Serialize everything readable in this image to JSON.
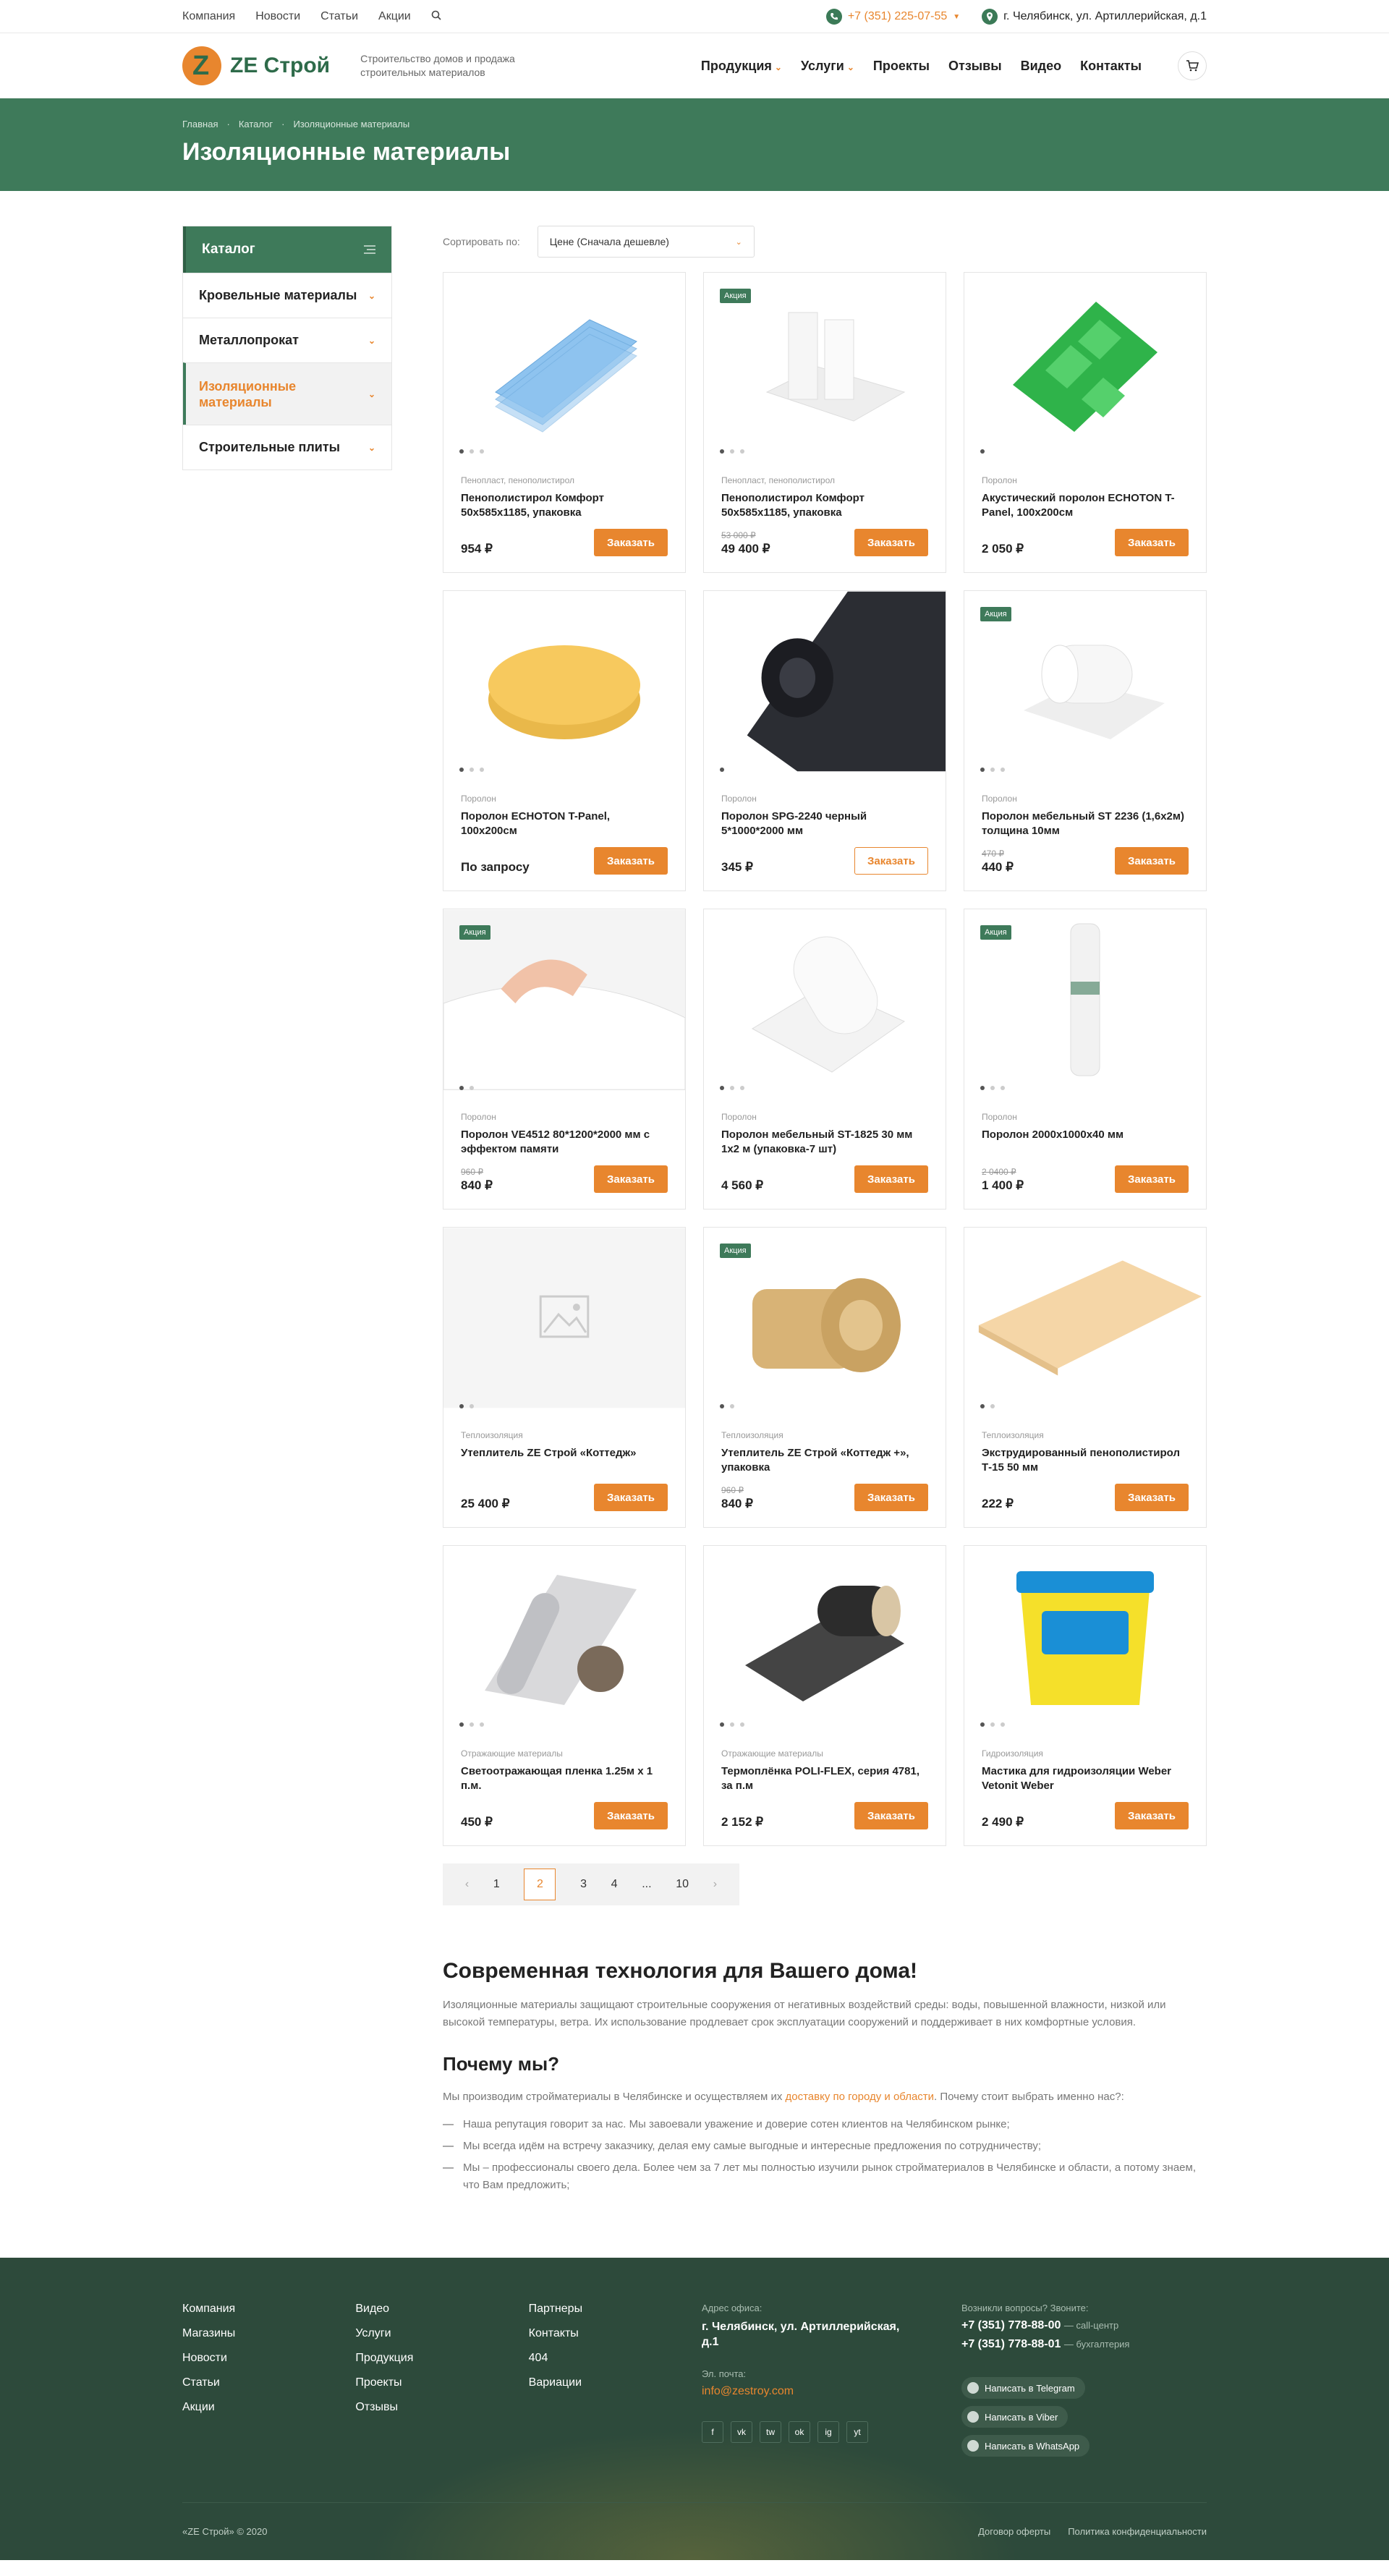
{
  "topnav": [
    "Компания",
    "Новости",
    "Статьи",
    "Акции"
  ],
  "phone": "+7 (351) 225-07-55",
  "address": "г. Челябинск, ул. Артиллерийская, д.1",
  "logo_text": "ZE Строй",
  "tagline": "Строительство домов и продажа строительных материалов",
  "mainnav": [
    {
      "label": "Продукция",
      "dropdown": true
    },
    {
      "label": "Услуги",
      "dropdown": true
    },
    {
      "label": "Проекты",
      "dropdown": false
    },
    {
      "label": "Отзывы",
      "dropdown": false
    },
    {
      "label": "Видео",
      "dropdown": false
    },
    {
      "label": "Контакты",
      "dropdown": false
    }
  ],
  "breadcrumbs": [
    "Главная",
    "Каталог",
    "Изоляционные материалы"
  ],
  "page_title": "Изоляционные материалы",
  "sidebar": {
    "title": "Каталог",
    "items": [
      {
        "label": "Кровельные материалы",
        "active": false
      },
      {
        "label": "Металлопрокат",
        "active": false
      },
      {
        "label": "Изоляционные материалы",
        "active": true
      },
      {
        "label": "Строительные плиты",
        "active": false
      }
    ]
  },
  "sort": {
    "label": "Сортировать по:",
    "value": "Цене (Сначала дешевле)"
  },
  "products": [
    {
      "img": "blue-boards",
      "badge": "",
      "dots": 3,
      "cat": "Пенопласт, пенополистирол",
      "title": "Пенополистирол Комфорт 50х585х1185, упаковка",
      "old": "",
      "price": "954 ₽",
      "btn": "Заказать",
      "outline": false
    },
    {
      "img": "white-blocks",
      "badge": "Акция",
      "dots": 3,
      "cat": "Пенопласт, пенополистирол",
      "title": "Пенополистирол Комфорт 50х585х1185, упаковка",
      "old": "53 000 ₽",
      "price": "49 400 ₽",
      "btn": "Заказать",
      "outline": false
    },
    {
      "img": "green-panel",
      "badge": "",
      "dots": 1,
      "cat": "Поролон",
      "title": "Акустический поролон ECHOTON T-Panel, 100х200см",
      "old": "",
      "price": "2 050 ₽",
      "btn": "Заказать",
      "outline": false
    },
    {
      "img": "yellow-disc",
      "badge": "",
      "dots": 3,
      "cat": "Поролон",
      "title": "Поролон ECHOTON T-Panel, 100х200см",
      "old": "",
      "price": "По запросу",
      "btn": "Заказать",
      "outline": false
    },
    {
      "img": "black-roll",
      "badge": "",
      "dots": 1,
      "cat": "Поролон",
      "title": "Поролон SPG-2240 черный 5*1000*2000 мм",
      "old": "",
      "price": "345 ₽",
      "btn": "Заказать",
      "outline": true
    },
    {
      "img": "white-roll",
      "badge": "Акция",
      "dots": 3,
      "cat": "Поролон",
      "title": "Поролон мебельный ST 2236 (1,6х2м) толщина 10мм",
      "old": "470 ₽",
      "price": "440 ₽",
      "btn": "Заказать",
      "outline": false
    },
    {
      "img": "memory-pillow",
      "badge": "Акция",
      "dots": 2,
      "cat": "Поролон",
      "title": "Поролон VE4512 80*1200*2000 мм с эффектом памяти",
      "old": "960 ₽",
      "price": "840 ₽",
      "btn": "Заказать",
      "outline": false
    },
    {
      "img": "foam-roll",
      "badge": "",
      "dots": 3,
      "cat": "Поролон",
      "title": "Поролон мебельный ST-1825 30 мм 1х2 м (упаковка-7 шт)",
      "old": "",
      "price": "4 560 ₽",
      "btn": "Заказать",
      "outline": false
    },
    {
      "img": "tall-roll",
      "badge": "Акция",
      "dots": 3,
      "cat": "Поролон",
      "title": "Поролон 2000х1000х40 мм",
      "old": "2 0400 ₽",
      "price": "1 400 ₽",
      "btn": "Заказать",
      "outline": false
    },
    {
      "img": "placeholder",
      "badge": "",
      "dots": 2,
      "cat": "Теплоизоляция",
      "title": "Утеплитель ZE Строй «Коттедж»",
      "old": "",
      "price": "25 400 ₽",
      "btn": "Заказать",
      "outline": false
    },
    {
      "img": "wool-roll",
      "badge": "Акция",
      "dots": 2,
      "cat": "Теплоизоляция",
      "title": "Утеплитель ZE Строй «Коттедж +», упаковка",
      "old": "960 ₽",
      "price": "840 ₽",
      "btn": "Заказать",
      "outline": false
    },
    {
      "img": "beige-board",
      "badge": "",
      "dots": 2,
      "cat": "Теплоизоляция",
      "title": "Экструдированный пенополистирол Т-15 50 мм",
      "old": "",
      "price": "222 ₽",
      "btn": "Заказать",
      "outline": false
    },
    {
      "img": "foil-rolls",
      "badge": "",
      "dots": 3,
      "cat": "Отражающие материалы",
      "title": "Светоотражающая пленка 1.25м х 1 п.м.",
      "old": "",
      "price": "450 ₽",
      "btn": "Заказать",
      "outline": false
    },
    {
      "img": "dark-roll",
      "badge": "",
      "dots": 3,
      "cat": "Отражающие материалы",
      "title": "Термоплёнка POLI-FLEX, серия 4781, за п.м",
      "old": "",
      "price": "2 152 ₽",
      "btn": "Заказать",
      "outline": false
    },
    {
      "img": "bucket",
      "badge": "",
      "dots": 3,
      "cat": "Гидроизоляция",
      "title": "Мастика для гидроизоляции Weber Vetonit Weber",
      "old": "",
      "price": "2 490 ₽",
      "btn": "Заказать",
      "outline": false
    }
  ],
  "pager": {
    "prev": "‹",
    "pages": [
      "1",
      "2",
      "3",
      "4",
      "...",
      "10"
    ],
    "current": "2",
    "next": "›"
  },
  "seo": {
    "h2": "Современная технология для Вашего дома!",
    "p1": "Изоляционные материалы защищают строительные сооружения от негативных воздействий среды: воды, повышенной влажности, низкой или высокой температуры, ветра. Их использование продлевает срок эксплуатации сооружений и поддерживает в них комфортные условия.",
    "h3": "Почему мы?",
    "p2_before": "Мы производим стройматериалы в Челябинске и осуществляем их ",
    "p2_link": "доставку по городу и области",
    "p2_after": ". Почему стоит выбрать именно нас?:",
    "list": [
      "Наша репутация говорит за нас. Мы завоевали уважение и доверие сотен клиентов на Челябинском рынке;",
      "Мы всегда идём на встречу заказчику, делая ему самые выгодные и интересные предложения по сотрудничеству;",
      "Мы – профессионалы своего дела. Более чем за 7 лет мы полностью изучили рынок стройматериалов в Челябинске и области, а потому знаем, что Вам предложить;"
    ]
  },
  "footer": {
    "col1": [
      "Компания",
      "Магазины",
      "Новости",
      "Статьи",
      "Акции"
    ],
    "col2": [
      "Видео",
      "Услуги",
      "Продукция",
      "Проекты",
      "Отзывы"
    ],
    "col3": [
      "Партнеры",
      "Контакты",
      "404",
      "Вариации"
    ],
    "addr_label": "Адрес офиса:",
    "addr": "г. Челябинск, ул. Артиллерийская, д.1",
    "email_label": "Эл. почта:",
    "email": "info@zestroy.com",
    "socials": [
      "f",
      "vk",
      "tw",
      "ok",
      "ig",
      "yt"
    ],
    "q_label": "Возникли вопросы? Звоните:",
    "phones": [
      {
        "num": "+7 (351) 778-88-00",
        "note": "— call-центр"
      },
      {
        "num": "+7 (351) 778-88-01",
        "note": "— бухгалтерия"
      }
    ],
    "messengers": [
      "Написать в Telegram",
      "Написать в Viber",
      "Написать в WhatsApp"
    ],
    "copyright": "«ZE Строй» © 2020",
    "links": [
      "Договор оферты",
      "Политика конфиденциальности"
    ]
  },
  "colors": {
    "accent": "#e8862e",
    "brand": "#3e7a5a",
    "footer": "#2d4a3b"
  }
}
